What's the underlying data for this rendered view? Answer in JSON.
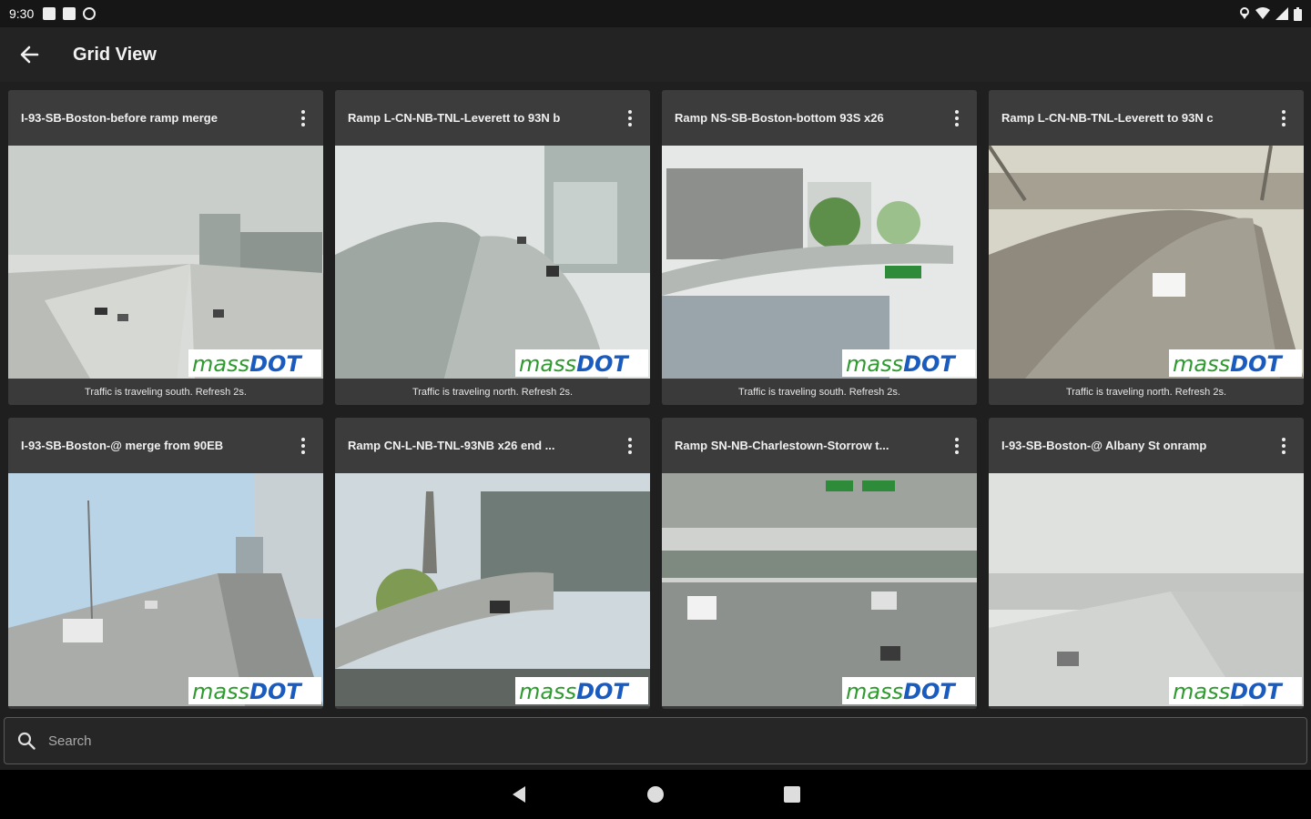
{
  "status_bar": {
    "time": "9:30",
    "left_icons": [
      "notification-box-icon",
      "sd-card-icon",
      "sync-icon"
    ],
    "right_icons": [
      "location-icon",
      "wifi-icon",
      "signal-icon",
      "battery-icon"
    ]
  },
  "app_bar": {
    "back_icon": "arrow-left-icon",
    "title": "Grid View"
  },
  "cameras": [
    {
      "title": "I-93-SB-Boston-before ramp merge",
      "caption": "Traffic is traveling south. Refresh 2s.",
      "logo_a": "mass",
      "logo_b": "DOT"
    },
    {
      "title": "Ramp L-CN-NB-TNL-Leverett to 93N b",
      "caption": "Traffic is traveling north. Refresh 2s.",
      "logo_a": "mass",
      "logo_b": "DOT"
    },
    {
      "title": "Ramp NS-SB-Boston-bottom 93S x26",
      "caption": "Traffic is traveling south. Refresh 2s.",
      "logo_a": "mass",
      "logo_b": "DOT"
    },
    {
      "title": "Ramp L-CN-NB-TNL-Leverett to 93N c",
      "caption": "Traffic is traveling north. Refresh 2s.",
      "logo_a": "mass",
      "logo_b": "DOT"
    },
    {
      "title": "I-93-SB-Boston-@ merge from 90EB",
      "caption": "",
      "logo_a": "mass",
      "logo_b": "DOT"
    },
    {
      "title": "Ramp CN-L-NB-TNL-93NB x26 end ...",
      "caption": "",
      "logo_a": "mass",
      "logo_b": "DOT"
    },
    {
      "title": "Ramp SN-NB-Charlestown-Storrow t...",
      "caption": "",
      "logo_a": "mass",
      "logo_b": "DOT"
    },
    {
      "title": "I-93-SB-Boston-@ Albany St onramp",
      "caption": "",
      "logo_a": "mass",
      "logo_b": "DOT"
    }
  ],
  "search": {
    "icon": "search-icon",
    "placeholder": "Search"
  },
  "nav_bar": {
    "buttons": [
      "back-triangle-icon",
      "home-circle-icon",
      "recents-square-icon"
    ]
  }
}
